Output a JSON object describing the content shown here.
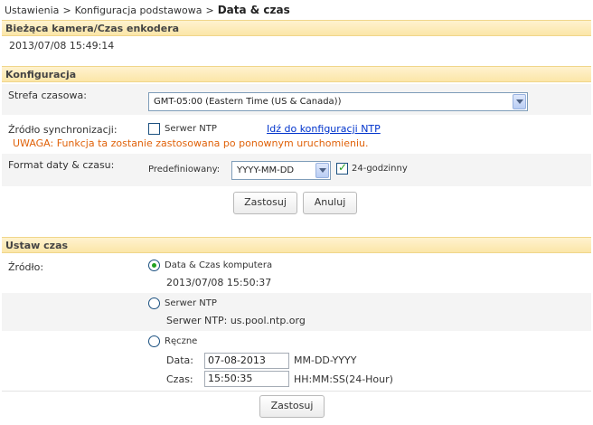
{
  "breadcrumb": {
    "items": [
      "Ustawienia",
      "Konfiguracja podstawowa"
    ],
    "separator": ">",
    "current": "Data & czas"
  },
  "current_time_section": {
    "title": "Bieżąca kamera/Czas enkodera",
    "datetime": "2013/07/08 15:49:14"
  },
  "config_section": {
    "title": "Konfiguracja",
    "timezone_label": "Strefa czasowa:",
    "timezone_value": "GMT-05:00 (Eastern Time (US & Canada))",
    "sync_label": "Źródło synchronizacji:",
    "ntp_checkbox_label": "Serwer NTP",
    "ntp_checked": false,
    "ntp_link": "Idź do konfiguracji NTP",
    "warning": "UWAGA: Funkcja ta zostanie zastosowana po ponownym uruchomieniu.",
    "format_label": "Format daty & czasu:",
    "predefined_label": "Predefiniowany:",
    "format_value": "YYYY-MM-DD",
    "hour24_label": "24-godzinny",
    "hour24_checked": true,
    "apply_button": "Zastosuj",
    "cancel_button": "Anuluj"
  },
  "set_time_section": {
    "title": "Ustaw czas",
    "source_label": "Źródło:",
    "options": {
      "computer": {
        "label": "Data & Czas komputera",
        "detail": "2013/07/08 15:50:37",
        "selected": true
      },
      "ntp": {
        "label": "Serwer NTP",
        "detail": "Serwer NTP: us.pool.ntp.org",
        "selected": false
      },
      "manual": {
        "label": "Ręczne",
        "selected": false
      }
    },
    "date_label": "Data:",
    "date_value": "07-08-2013",
    "date_format": "MM-DD-YYYY",
    "time_label": "Czas:",
    "time_value": "15:50:35",
    "time_format": "HH:MM:SS(24-Hour)",
    "apply_button": "Zastosuj"
  },
  "colors": {
    "section_header": "#fbe6a8",
    "warning": "#e0620a",
    "link": "#0033cc",
    "check_green": "#21a121"
  }
}
